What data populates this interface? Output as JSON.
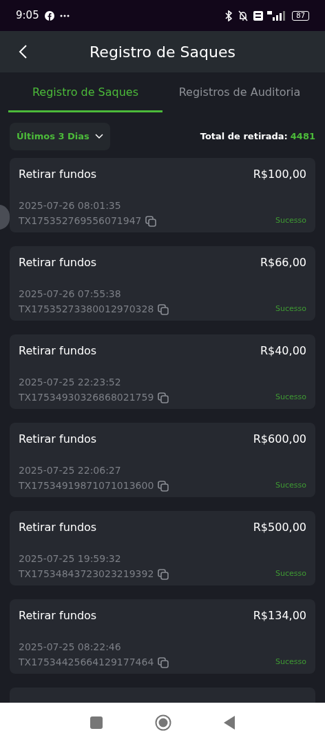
{
  "status_bar": {
    "time": "9:05",
    "battery": "87"
  },
  "header": {
    "title": "Registro de Saques"
  },
  "tabs": [
    {
      "label": "Registro de Saques",
      "selected": true
    },
    {
      "label": "Registros de Auditoria",
      "selected": false
    }
  ],
  "filter": {
    "label": "Últimos 3 Dias"
  },
  "total": {
    "label": "Total de retirada:",
    "value": "4481"
  },
  "records": [
    {
      "type": "Retirar fundos",
      "amount": "R$100,00",
      "datetime": "2025-07-26 08:01:35",
      "tx": "TX175352769556071947",
      "status": "Sucesso"
    },
    {
      "type": "Retirar fundos",
      "amount": "R$66,00",
      "datetime": "2025-07-26 07:55:38",
      "tx": "TX17535273380012970328",
      "status": "Sucesso"
    },
    {
      "type": "Retirar fundos",
      "amount": "R$40,00",
      "datetime": "2025-07-25 22:23:52",
      "tx": "TX17534930326868021759",
      "status": "Sucesso"
    },
    {
      "type": "Retirar fundos",
      "amount": "R$600,00",
      "datetime": "2025-07-25 22:06:27",
      "tx": "TX17534919871071013600",
      "status": "Sucesso"
    },
    {
      "type": "Retirar fundos",
      "amount": "R$500,00",
      "datetime": "2025-07-25 19:59:32",
      "tx": "TX17534843723023219392",
      "status": "Sucesso"
    },
    {
      "type": "Retirar fundos",
      "amount": "R$134,00",
      "datetime": "2025-07-25 08:22:46",
      "tx": "TX17534425664129177464",
      "status": "Sucesso"
    }
  ]
}
